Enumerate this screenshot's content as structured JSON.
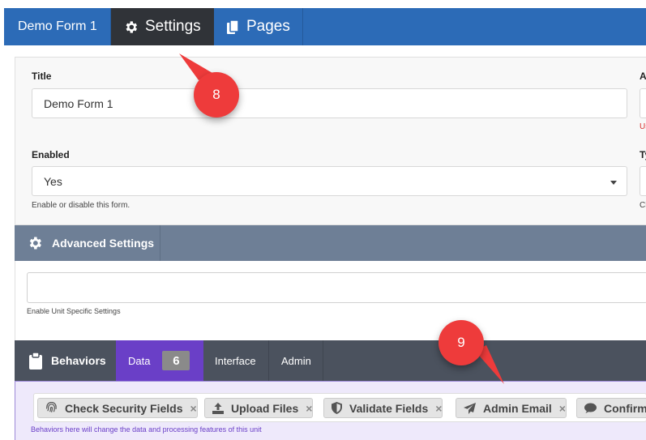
{
  "top_tabs": [
    {
      "label": "Demo Form 1"
    },
    {
      "label": "Settings",
      "icon": "gear-icon"
    },
    {
      "label": "Pages",
      "icon": "pages-icon"
    }
  ],
  "settings": {
    "title_label": "Title",
    "title_value": "Demo Form 1",
    "enabled_label": "Enabled",
    "enabled_value": "Yes",
    "enabled_hint": "Enable or disable this form.",
    "right_label_1": "A",
    "right_hint_1": "Us",
    "right_label_2": "Ty",
    "right_hint_2": "Cl"
  },
  "advanced": {
    "header": "Advanced Settings",
    "hint": "Enable Unit Specific Settings"
  },
  "behaviors": {
    "header": "Behaviors",
    "tabs": [
      {
        "label": "Data",
        "count": "6"
      },
      {
        "label": "Interface"
      },
      {
        "label": "Admin"
      }
    ],
    "chips": [
      {
        "label": "Check Security Fields",
        "icon": "fingerprint-icon"
      },
      {
        "label": "Upload Files",
        "icon": "upload-icon"
      },
      {
        "label": "Validate Fields",
        "icon": "shield-icon"
      },
      {
        "label": "Admin Email",
        "icon": "paper-plane-icon"
      },
      {
        "label": "Confirm",
        "icon": "speech-bubble-icon"
      }
    ],
    "remove_symbol": "×",
    "hint": "Behaviors here will change the data and processing features of this unit"
  },
  "callouts": [
    "8",
    "9"
  ],
  "colors": {
    "topbar": "#2c6bb7",
    "active_tab": "#303338",
    "advanced_header": "#6e7f96",
    "behaviors_header": "#4b525e",
    "behaviors_active_tab": "#6a3fc7",
    "callout": "#ee3b3b"
  }
}
